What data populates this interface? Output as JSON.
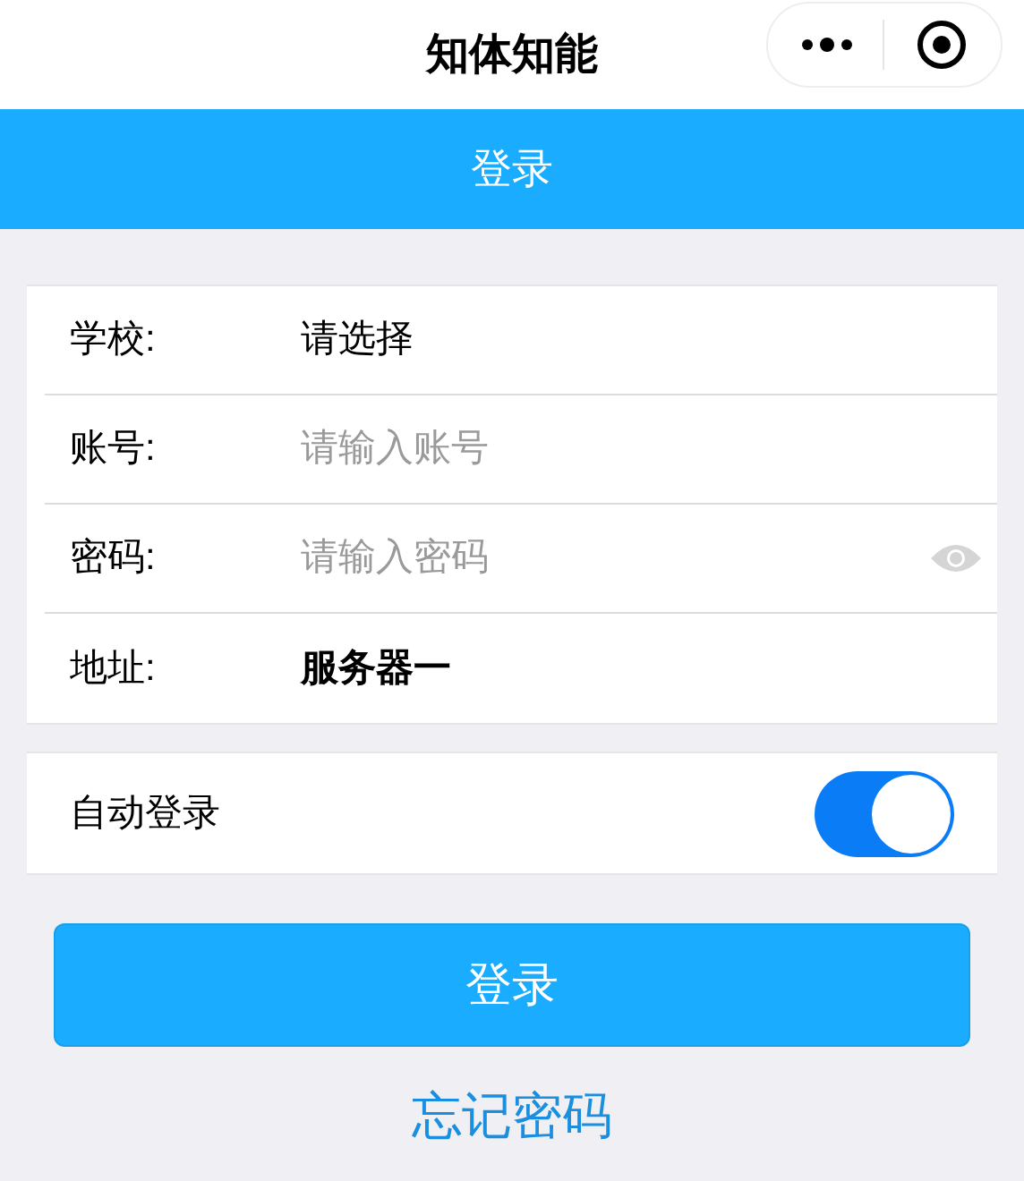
{
  "nav_bar": {
    "title": "知体知能"
  },
  "header": {
    "title": "登录"
  },
  "form": [
    {
      "kind": "picker",
      "label": "学校:",
      "value": "请选择"
    },
    {
      "kind": "input",
      "label": "账号:",
      "placeholder": "请输入账号"
    },
    {
      "kind": "password",
      "label": "密码:",
      "placeholder": "请输入密码"
    },
    {
      "kind": "server",
      "label": "地址:",
      "value": "服务器一"
    }
  ],
  "auto_login": {
    "label": "自动登录",
    "on": true
  },
  "login_button": "登录",
  "forgot_link": "忘记密码"
}
